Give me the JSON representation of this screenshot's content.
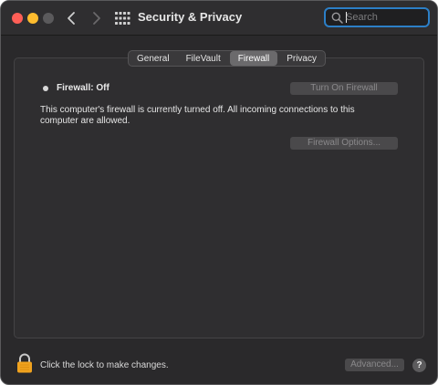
{
  "window": {
    "title": "Security & Privacy"
  },
  "search": {
    "placeholder": "Search",
    "value": ""
  },
  "tabs": [
    {
      "label": "General",
      "active": false
    },
    {
      "label": "FileVault",
      "active": false
    },
    {
      "label": "Firewall",
      "active": true
    },
    {
      "label": "Privacy",
      "active": false
    }
  ],
  "firewall": {
    "status_label": "Firewall: Off",
    "turn_on_label": "Turn On Firewall",
    "description": "This computer's firewall is currently turned off. All incoming connections to this computer are allowed.",
    "options_label": "Firewall Options..."
  },
  "footer": {
    "lock_text": "Click the lock to make changes.",
    "advanced_label": "Advanced...",
    "help_label": "?"
  },
  "icons": {
    "close": "traffic-light-close",
    "minimize": "traffic-light-minimize",
    "zoom": "traffic-light-zoom",
    "back": "chevron-left-icon",
    "forward": "chevron-right-icon",
    "show_all": "grid-icon",
    "search": "search-icon",
    "lock": "lock-icon"
  },
  "colors": {
    "window_bg": "#2a292b",
    "accent_focus": "#2c7fc7",
    "close": "#ff5f57",
    "minimize": "#febc2e",
    "lock": "#f0a21e"
  }
}
